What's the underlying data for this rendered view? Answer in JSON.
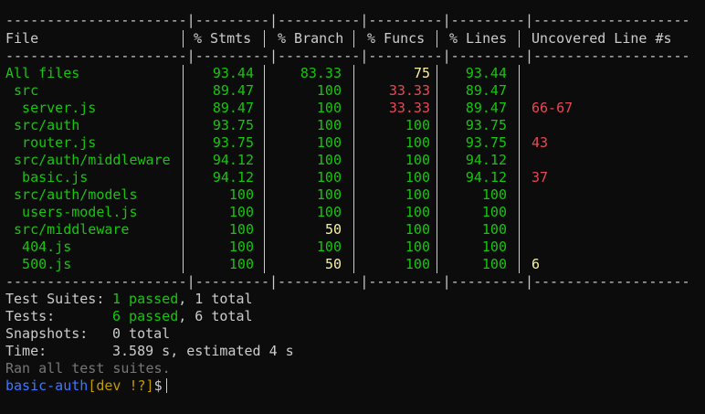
{
  "coverage": {
    "headers": {
      "file": "File",
      "stmts": "% Stmts",
      "branch": "% Branch",
      "funcs": "% Funcs",
      "lines": "% Lines",
      "uncovered": "Uncovered Line #s"
    },
    "rows": [
      {
        "file": "All files",
        "stmts": "93.44",
        "branch": "83.33",
        "funcs": "75",
        "lines": "93.44",
        "uncovered": ""
      },
      {
        "file": " src",
        "stmts": "89.47",
        "branch": "100",
        "funcs": "33.33",
        "lines": "89.47",
        "uncovered": ""
      },
      {
        "file": "  server.js",
        "stmts": "89.47",
        "branch": "100",
        "funcs": "33.33",
        "lines": "89.47",
        "uncovered": "66-67"
      },
      {
        "file": " src/auth",
        "stmts": "93.75",
        "branch": "100",
        "funcs": "100",
        "lines": "93.75",
        "uncovered": ""
      },
      {
        "file": "  router.js",
        "stmts": "93.75",
        "branch": "100",
        "funcs": "100",
        "lines": "93.75",
        "uncovered": "43"
      },
      {
        "file": " src/auth/middleware",
        "stmts": "94.12",
        "branch": "100",
        "funcs": "100",
        "lines": "94.12",
        "uncovered": ""
      },
      {
        "file": "  basic.js",
        "stmts": "94.12",
        "branch": "100",
        "funcs": "100",
        "lines": "94.12",
        "uncovered": "37"
      },
      {
        "file": " src/auth/models",
        "stmts": "100",
        "branch": "100",
        "funcs": "100",
        "lines": "100",
        "uncovered": ""
      },
      {
        "file": "  users-model.js",
        "stmts": "100",
        "branch": "100",
        "funcs": "100",
        "lines": "100",
        "uncovered": ""
      },
      {
        "file": " src/middleware",
        "stmts": "100",
        "branch": "50",
        "funcs": "100",
        "lines": "100",
        "uncovered": ""
      },
      {
        "file": "  404.js",
        "stmts": "100",
        "branch": "100",
        "funcs": "100",
        "lines": "100",
        "uncovered": ""
      },
      {
        "file": "  500.js",
        "stmts": "100",
        "branch": "50",
        "funcs": "100",
        "lines": "100",
        "uncovered": "6"
      }
    ]
  },
  "summary": {
    "suites_label": "Test Suites:",
    "suites_passed": "1 passed",
    "suites_total": ", 1 total",
    "tests_label": "Tests:",
    "tests_passed": "6 passed",
    "tests_total": ", 6 total",
    "snapshots_label": "Snapshots:",
    "snapshots_value": "0 total",
    "time_label": "Time:",
    "time_value": "3.589 s, estimated 4 s",
    "ran": "Ran all test suites."
  },
  "prompt": {
    "dir": "basic-auth",
    "branch": "[dev !?]",
    "symbol": "$"
  },
  "colors": {
    "background": "#0c0c0c",
    "text": "#cccccc",
    "green": "#16c60c",
    "red": "#e74856",
    "yellow": "#f9f1a5",
    "gray": "#767676",
    "blue": "#3b78ff",
    "gold": "#c19c00"
  }
}
